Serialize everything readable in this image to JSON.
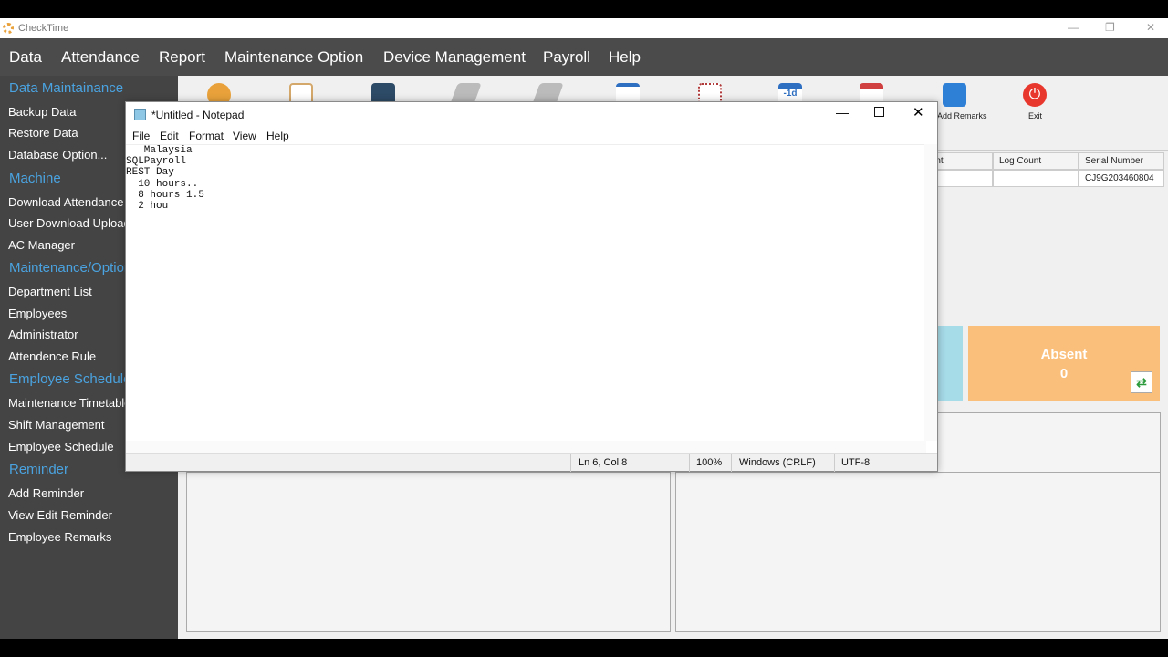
{
  "app": {
    "title": "CheckTime"
  },
  "menubar": [
    "Data",
    "Attendance",
    "Report",
    "Maintenance Option",
    "Device Management",
    "Payroll",
    "Help"
  ],
  "sidebar": {
    "sections": [
      {
        "title": "Data Maintainance",
        "items": [
          "Backup Data",
          "Restore Data",
          "Database Option..."
        ]
      },
      {
        "title": "Machine",
        "items": [
          "Download Attendance",
          "User Download Upload",
          "AC Manager"
        ]
      },
      {
        "title": "Maintenance/Option",
        "items": [
          "Department List",
          "Employees",
          "Administrator",
          "Attendence Rule"
        ]
      },
      {
        "title": "Employee Schedule",
        "items": [
          "Maintenance Timetable",
          "Shift Management",
          "Employee Schedule"
        ]
      },
      {
        "title": "Reminder",
        "items": [
          "Add Reminder",
          "View Edit Reminder",
          "Employee Remarks"
        ]
      }
    ]
  },
  "toolbar": {
    "remarks_label": "Add Remarks",
    "exit_label": "Exit",
    "day_badge": "-1d"
  },
  "device_table": {
    "headers": [
      "Count",
      "Log Count",
      "Serial Number"
    ],
    "row": [
      "",
      "",
      "CJ9G203460804"
    ]
  },
  "cards": {
    "absent_label": "Absent",
    "absent_value": "0"
  },
  "notepad": {
    "title": "*Untitled - Notepad",
    "menu": [
      "File",
      "Edit",
      "Format",
      "View",
      "Help"
    ],
    "text": "   Malaysia\nSQLPayroll\nREST Day\n  10 hours..\n  8 hours 1.5\n  2 hou",
    "status": {
      "position": "Ln 6, Col 8",
      "zoom": "100%",
      "line_ending": "Windows (CRLF)",
      "encoding": "UTF-8"
    }
  },
  "colors": {
    "menubar": "#4b4b4b",
    "sidebar": "#444444",
    "sidebar_heading": "#4aa3e0",
    "absent_card": "#fbbf7c",
    "present_card": "#a6dbe8"
  }
}
